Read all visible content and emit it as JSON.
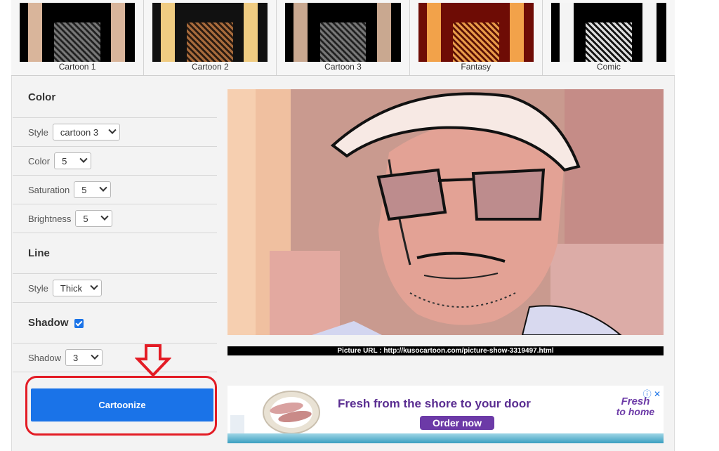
{
  "thumbnails": [
    {
      "label": "Cartoon 1"
    },
    {
      "label": "Cartoon 2"
    },
    {
      "label": "Cartoon 3"
    },
    {
      "label": "Fantasy"
    },
    {
      "label": "Comic"
    }
  ],
  "color_section": {
    "title": "Color",
    "style": {
      "label": "Style",
      "value": "cartoon 3"
    },
    "color": {
      "label": "Color",
      "value": "5"
    },
    "saturation": {
      "label": "Saturation",
      "value": "5"
    },
    "brightness": {
      "label": "Brightness",
      "value": "5"
    }
  },
  "line_section": {
    "title": "Line",
    "style": {
      "label": "Style",
      "value": "Thick"
    }
  },
  "shadow_section": {
    "title": "Shadow",
    "enabled": true,
    "shadow": {
      "label": "Shadow",
      "value": "3"
    }
  },
  "action": {
    "label": "Cartoonize"
  },
  "picture_url": "Picture URL : http://kusocartoon.com/picture-show-3319497.html",
  "ad": {
    "headline": "Fresh from the shore to your door",
    "cta": "Order now",
    "brand_line1": "Fresh",
    "brand_line2": "to home",
    "close_icon": "ⓘ ✕"
  },
  "colors": {
    "accent_blue": "#1a73e8",
    "highlight_red": "#e31c25",
    "ad_purple": "#5a2d91"
  }
}
